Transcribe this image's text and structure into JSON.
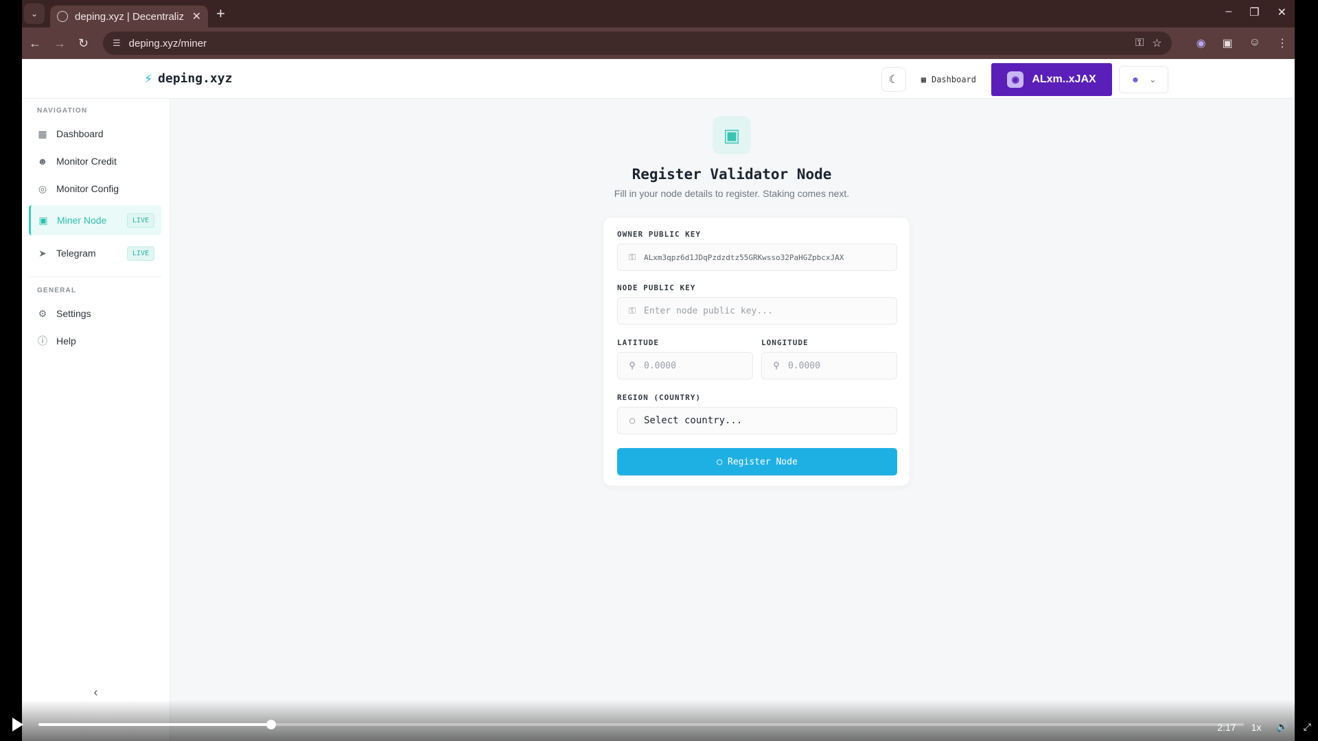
{
  "browser": {
    "tab_title": "deping.xyz | Decentraliz",
    "url": "deping.xyz/miner"
  },
  "app": {
    "brand": "deping.xyz",
    "header": {
      "dashboard_label": "Dashboard",
      "wallet_label": "ALxm..xJAX"
    },
    "sidebar": {
      "nav_section": "NAVIGATION",
      "general_section": "GENERAL",
      "nav_items": [
        {
          "label": "Dashboard",
          "icon": "grid-icon"
        },
        {
          "label": "Monitor Credit",
          "icon": "user-icon"
        },
        {
          "label": "Monitor Config",
          "icon": "target-icon"
        },
        {
          "label": "Miner Node",
          "icon": "chip-icon",
          "badge": "LIVE",
          "active": true
        },
        {
          "label": "Telegram",
          "icon": "send-icon",
          "badge": "LIVE"
        }
      ],
      "general_items": [
        {
          "label": "Settings",
          "icon": "gear-icon"
        },
        {
          "label": "Help",
          "icon": "help-icon"
        }
      ]
    },
    "form": {
      "title": "Register Validator Node",
      "subtitle": "Fill in your node details to register. Staking comes next.",
      "owner_label": "OWNER PUBLIC KEY",
      "owner_value": "ALxm3qpz6d1JDqPzdzdtz55GRKwsso32PaHGZpbcxJAX",
      "node_label": "NODE PUBLIC KEY",
      "node_placeholder": "Enter node public key...",
      "lat_label": "LATITUDE",
      "lat_placeholder": "0.0000",
      "lon_label": "LONGITUDE",
      "lon_placeholder": "0.0000",
      "region_label": "REGION (COUNTRY)",
      "region_value": "Select country...",
      "submit_label": "Register Node"
    },
    "colors": {
      "accent": "#1fb0e3",
      "wallet": "#5a1fb8",
      "active": "#2fbfae"
    }
  },
  "player": {
    "time": "2:17",
    "speed": "1x",
    "progress_percent": 19.3
  }
}
